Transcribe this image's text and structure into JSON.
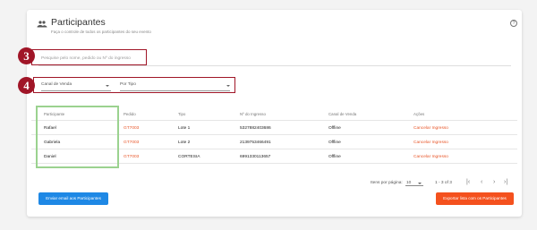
{
  "header": {
    "title": "Participantes",
    "subtitle": "Faça o controle de todos os participantes do seu evento",
    "help": "?"
  },
  "annotations": {
    "three": "3",
    "four": "4"
  },
  "search": {
    "placeholder": "Pesquise pelo nome, pedido ou Nº do ingresso"
  },
  "filters": {
    "channel": "Canal de Venda",
    "type": "Por Tipo"
  },
  "table": {
    "headers": [
      "Participante",
      "Pedido",
      "Tipo",
      "Nº do Ingresso",
      "Canal de Venda",
      "Ações"
    ],
    "rows": [
      [
        "Rafael",
        "GT7003",
        "Lote 1",
        "5327882403686",
        "Offline",
        "Cancelar Ingresso"
      ],
      [
        "Gabriela",
        "GT7003",
        "Lote 2",
        "2139753466491",
        "Offline",
        "Cancelar Ingresso"
      ],
      [
        "Daniel",
        "GT7003",
        "CORTESIA",
        "6991330113657",
        "Offline",
        "Cancelar Ingresso"
      ]
    ]
  },
  "pagination": {
    "per_page_label": "Itens por página:",
    "per_page": "10",
    "range": "1 - 3 of 3"
  },
  "buttons": {
    "email": "Enviar email aos Participantes",
    "export": "Exportar lista com os Participantes"
  },
  "colors": {
    "accent": "#e8572a",
    "annotation": "#a01527",
    "primary": "#1e88e5",
    "highlight_green": "#9bd28f"
  }
}
